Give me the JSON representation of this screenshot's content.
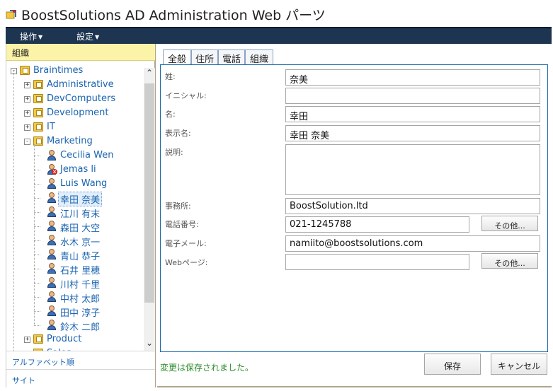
{
  "title": "BoostSolutions AD Administration Web パーツ",
  "menu": [
    {
      "label": "操作"
    },
    {
      "label": "設定"
    }
  ],
  "left_panel": {
    "header": "組織",
    "footer": [
      "アルファベット順",
      "サイト"
    ]
  },
  "tree": {
    "root": "Braintimes",
    "folders_top": [
      "Administrative",
      "DevComputers",
      "Development",
      "IT"
    ],
    "expanded_folder": "Marketing",
    "users": [
      "Cecilia Wen",
      "Jemas li",
      "Luis Wang",
      "幸田 奈美",
      "江川 有末",
      "森田 大空",
      "水木 京一",
      "青山 恭子",
      "石井 里穂",
      "川村 千里",
      "中村 太郎",
      "田中 淳子",
      "鈴木 二郎"
    ],
    "disabled_user": "Jemas li",
    "selected_user": "幸田 奈美",
    "folders_bottom": [
      "Product",
      "Sales"
    ]
  },
  "tabs": [
    "全般",
    "住所",
    "電話",
    "組織"
  ],
  "active_tab": "全般",
  "form": {
    "last_name_label": "姓:",
    "last_name_value": "奈美",
    "initials_label": "イニシャル:",
    "initials_value": "",
    "first_name_label": "名:",
    "first_name_value": "幸田",
    "display_name_label": "表示名:",
    "display_name_value": "幸田 奈美",
    "description_label": "説明:",
    "description_value": "",
    "office_label": "事務所:",
    "office_value": "BoostSolution.ltd",
    "phone_label": "電話番号:",
    "phone_value": "021-1245788",
    "phone_other": "その他...",
    "email_label": "電子メール:",
    "email_value": "namiito@boostsolutions.com",
    "web_label": "Webページ:",
    "web_value": "",
    "web_other": "その他..."
  },
  "status_message": "変更は保存されました。",
  "save_label": "保存",
  "cancel_label": "キャンセル",
  "colors": {
    "menu_bar": "#1d3550",
    "panel_header": "#fbf3a8",
    "link": "#1a63b0",
    "form_border": "#1c6aa7",
    "status": "#2a8a2a"
  }
}
